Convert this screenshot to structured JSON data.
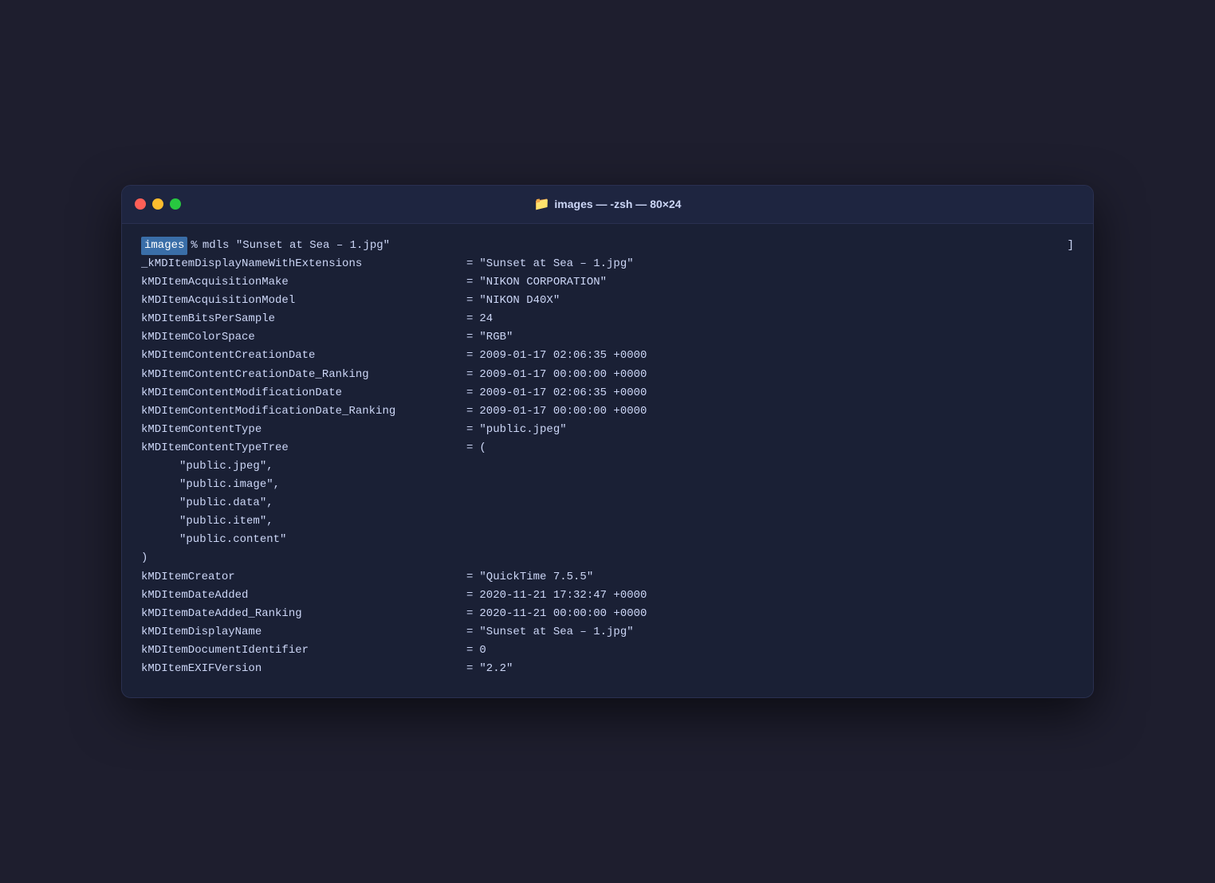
{
  "window": {
    "title": "images — -zsh — 80×24",
    "folder_icon": "📁"
  },
  "traffic_lights": {
    "close": "close",
    "minimize": "minimize",
    "maximize": "maximize"
  },
  "terminal": {
    "prompt_dir": "images",
    "prompt_symbol": "%",
    "command": "mdls \"Sunset at Sea – 1.jpg\"",
    "rows": [
      {
        "key": "_kMDItemDisplayNameWithExtensions",
        "eq": "=",
        "value": "\"Sunset at Sea – 1.jpg\""
      },
      {
        "key": "kMDItemAcquisitionMake",
        "eq": "=",
        "value": "\"NIKON CORPORATION\""
      },
      {
        "key": "kMDItemAcquisitionModel",
        "eq": "=",
        "value": "\"NIKON D40X\""
      },
      {
        "key": "kMDItemBitsPerSample",
        "eq": "=",
        "value": "24"
      },
      {
        "key": "kMDItemColorSpace",
        "eq": "=",
        "value": "\"RGB\""
      },
      {
        "key": "kMDItemContentCreationDate",
        "eq": "=",
        "value": "2009-01-17 02:06:35 +0000"
      },
      {
        "key": "kMDItemContentCreationDate_Ranking",
        "eq": "=",
        "value": "2009-01-17 00:00:00 +0000"
      },
      {
        "key": "kMDItemContentModificationDate",
        "eq": "=",
        "value": "2009-01-17 02:06:35 +0000"
      },
      {
        "key": "kMDItemContentModificationDate_Ranking",
        "eq": "=",
        "value": "2009-01-17 00:00:00 +0000"
      },
      {
        "key": "kMDItemContentType",
        "eq": "=",
        "value": "\"public.jpeg\""
      },
      {
        "key": "kMDItemContentTypeTree",
        "eq": "=",
        "value": "("
      }
    ],
    "tree_items": [
      "\"public.jpeg\",",
      "\"public.image\",",
      "\"public.data\",",
      "\"public.item\",",
      "\"public.content\""
    ],
    "tree_close": ")",
    "rows2": [
      {
        "key": "kMDItemCreator",
        "eq": "=",
        "value": "\"QuickTime 7.5.5\""
      },
      {
        "key": "kMDItemDateAdded",
        "eq": "=",
        "value": "2020-11-21 17:32:47 +0000"
      },
      {
        "key": "kMDItemDateAdded_Ranking",
        "eq": "=",
        "value": "2020-11-21 00:00:00 +0000"
      },
      {
        "key": "kMDItemDisplayName",
        "eq": "=",
        "value": "\"Sunset at Sea – 1.jpg\""
      },
      {
        "key": "kMDItemDocumentIdentifier",
        "eq": "=",
        "value": "0"
      },
      {
        "key": "kMDItemEXIFVersion",
        "eq": "=",
        "value": "\"2.2\""
      }
    ]
  }
}
